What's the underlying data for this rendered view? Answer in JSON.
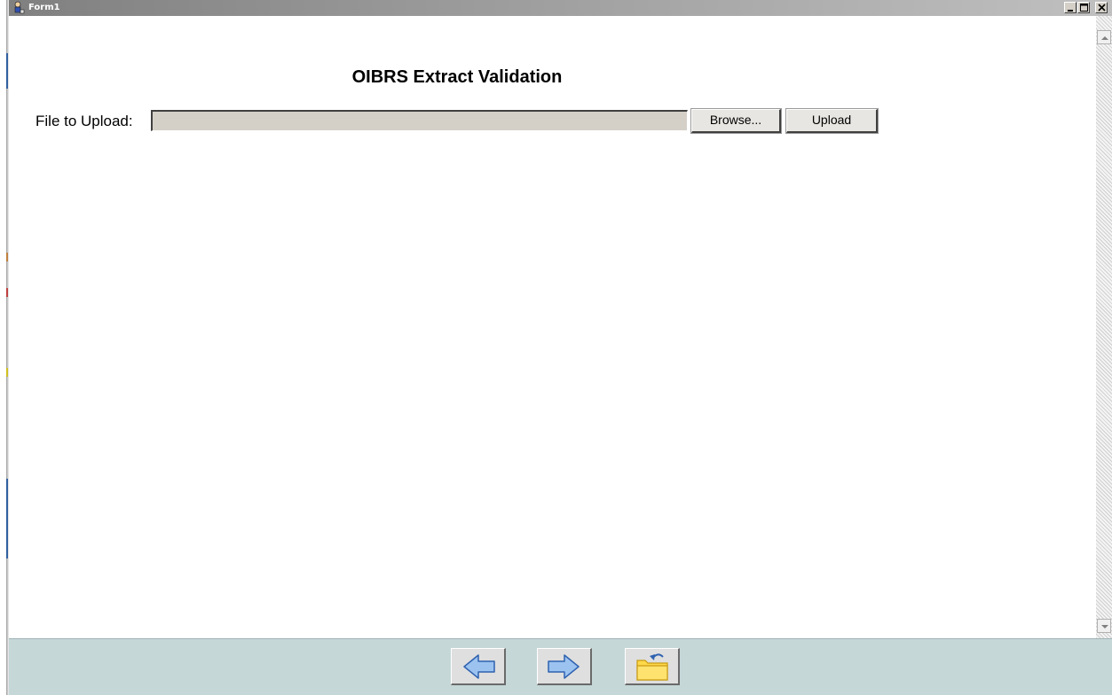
{
  "window": {
    "title": "Form1",
    "icon": "app-icon"
  },
  "form": {
    "heading": "OIBRS Extract Validation",
    "file_label": "File to Upload:",
    "file_value": "",
    "browse_label": "Browse...",
    "upload_label": "Upload"
  },
  "toolbar": {
    "buttons": [
      {
        "name": "back",
        "icon": "arrow-left-icon"
      },
      {
        "name": "forward",
        "icon": "arrow-right-icon"
      },
      {
        "name": "open-folder",
        "icon": "folder-return-icon"
      }
    ]
  },
  "colors": {
    "bottom_bar": "#c6d7d8",
    "arrow_fill": "#9cc3f0",
    "folder_fill": "#ffd94a"
  }
}
